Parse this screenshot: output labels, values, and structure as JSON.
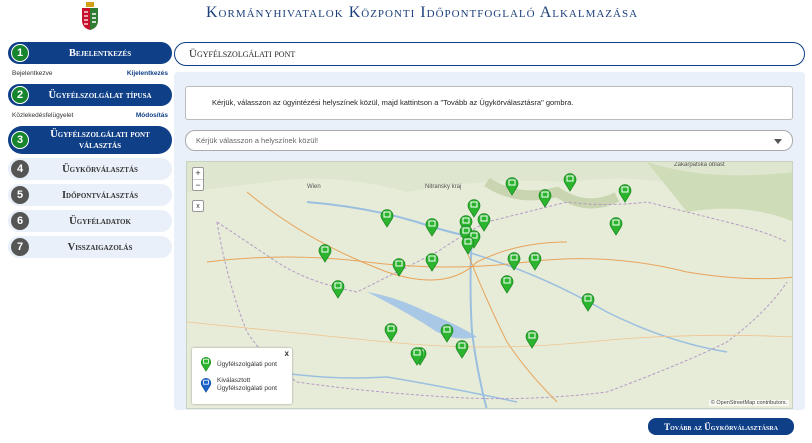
{
  "app": {
    "title": "Kormányhivatalok Központi Időpontfoglaló Alkalmazása"
  },
  "sidebar": {
    "steps": [
      {
        "num": "1",
        "label": "Bejelentkezés",
        "state": "done",
        "sub_left": "Bejelentkezve",
        "sub_link": "Kijelentkezés"
      },
      {
        "num": "2",
        "label": "Ügyfélszolgálat típusa",
        "state": "done",
        "sub_left": "Közlekedésfelügyelet",
        "sub_link": "Módosítás"
      },
      {
        "num": "3",
        "label": "Ügyfélszolgálati pont választás",
        "state": "active"
      },
      {
        "num": "4",
        "label": "Ügykörválasztás",
        "state": "todo"
      },
      {
        "num": "5",
        "label": "Időpontválasztás",
        "state": "todo"
      },
      {
        "num": "6",
        "label": "Ügyféladatok",
        "state": "todo"
      },
      {
        "num": "7",
        "label": "Visszaigazolás",
        "state": "todo"
      }
    ]
  },
  "main": {
    "section_title": "Ügyfélszolgálati pont",
    "instructions": "Kérjük, válasszon az ügyintézési helyszínek közül, majd kattintson a \"Tovább az Ügykörválasztásra\" gombra.",
    "select_placeholder": "Kérjük válasszon a helyszínek közül!"
  },
  "map": {
    "zoom_in": "+",
    "zoom_out": "−",
    "reset": "x",
    "attribution": "© OpenStreetMap contributors.",
    "place_labels": [
      "Wien",
      "Nitransky kraj",
      "Zakarpatska oblast"
    ],
    "legend": {
      "close": "x",
      "items": [
        {
          "label": "Ügyfélszolgálati pont",
          "color": "#2bb52f"
        },
        {
          "label": "Kiválasztott Ügyfélszolgálati pont",
          "color": "#1a63c9"
        }
      ]
    }
  },
  "footer": {
    "next_button": "Tovább az Ügykörválasztásra"
  },
  "colors": {
    "primary": "#0e3f87",
    "step_done": "#16852e",
    "pin": "#2bb52f",
    "pin_selected": "#1a63c9"
  }
}
